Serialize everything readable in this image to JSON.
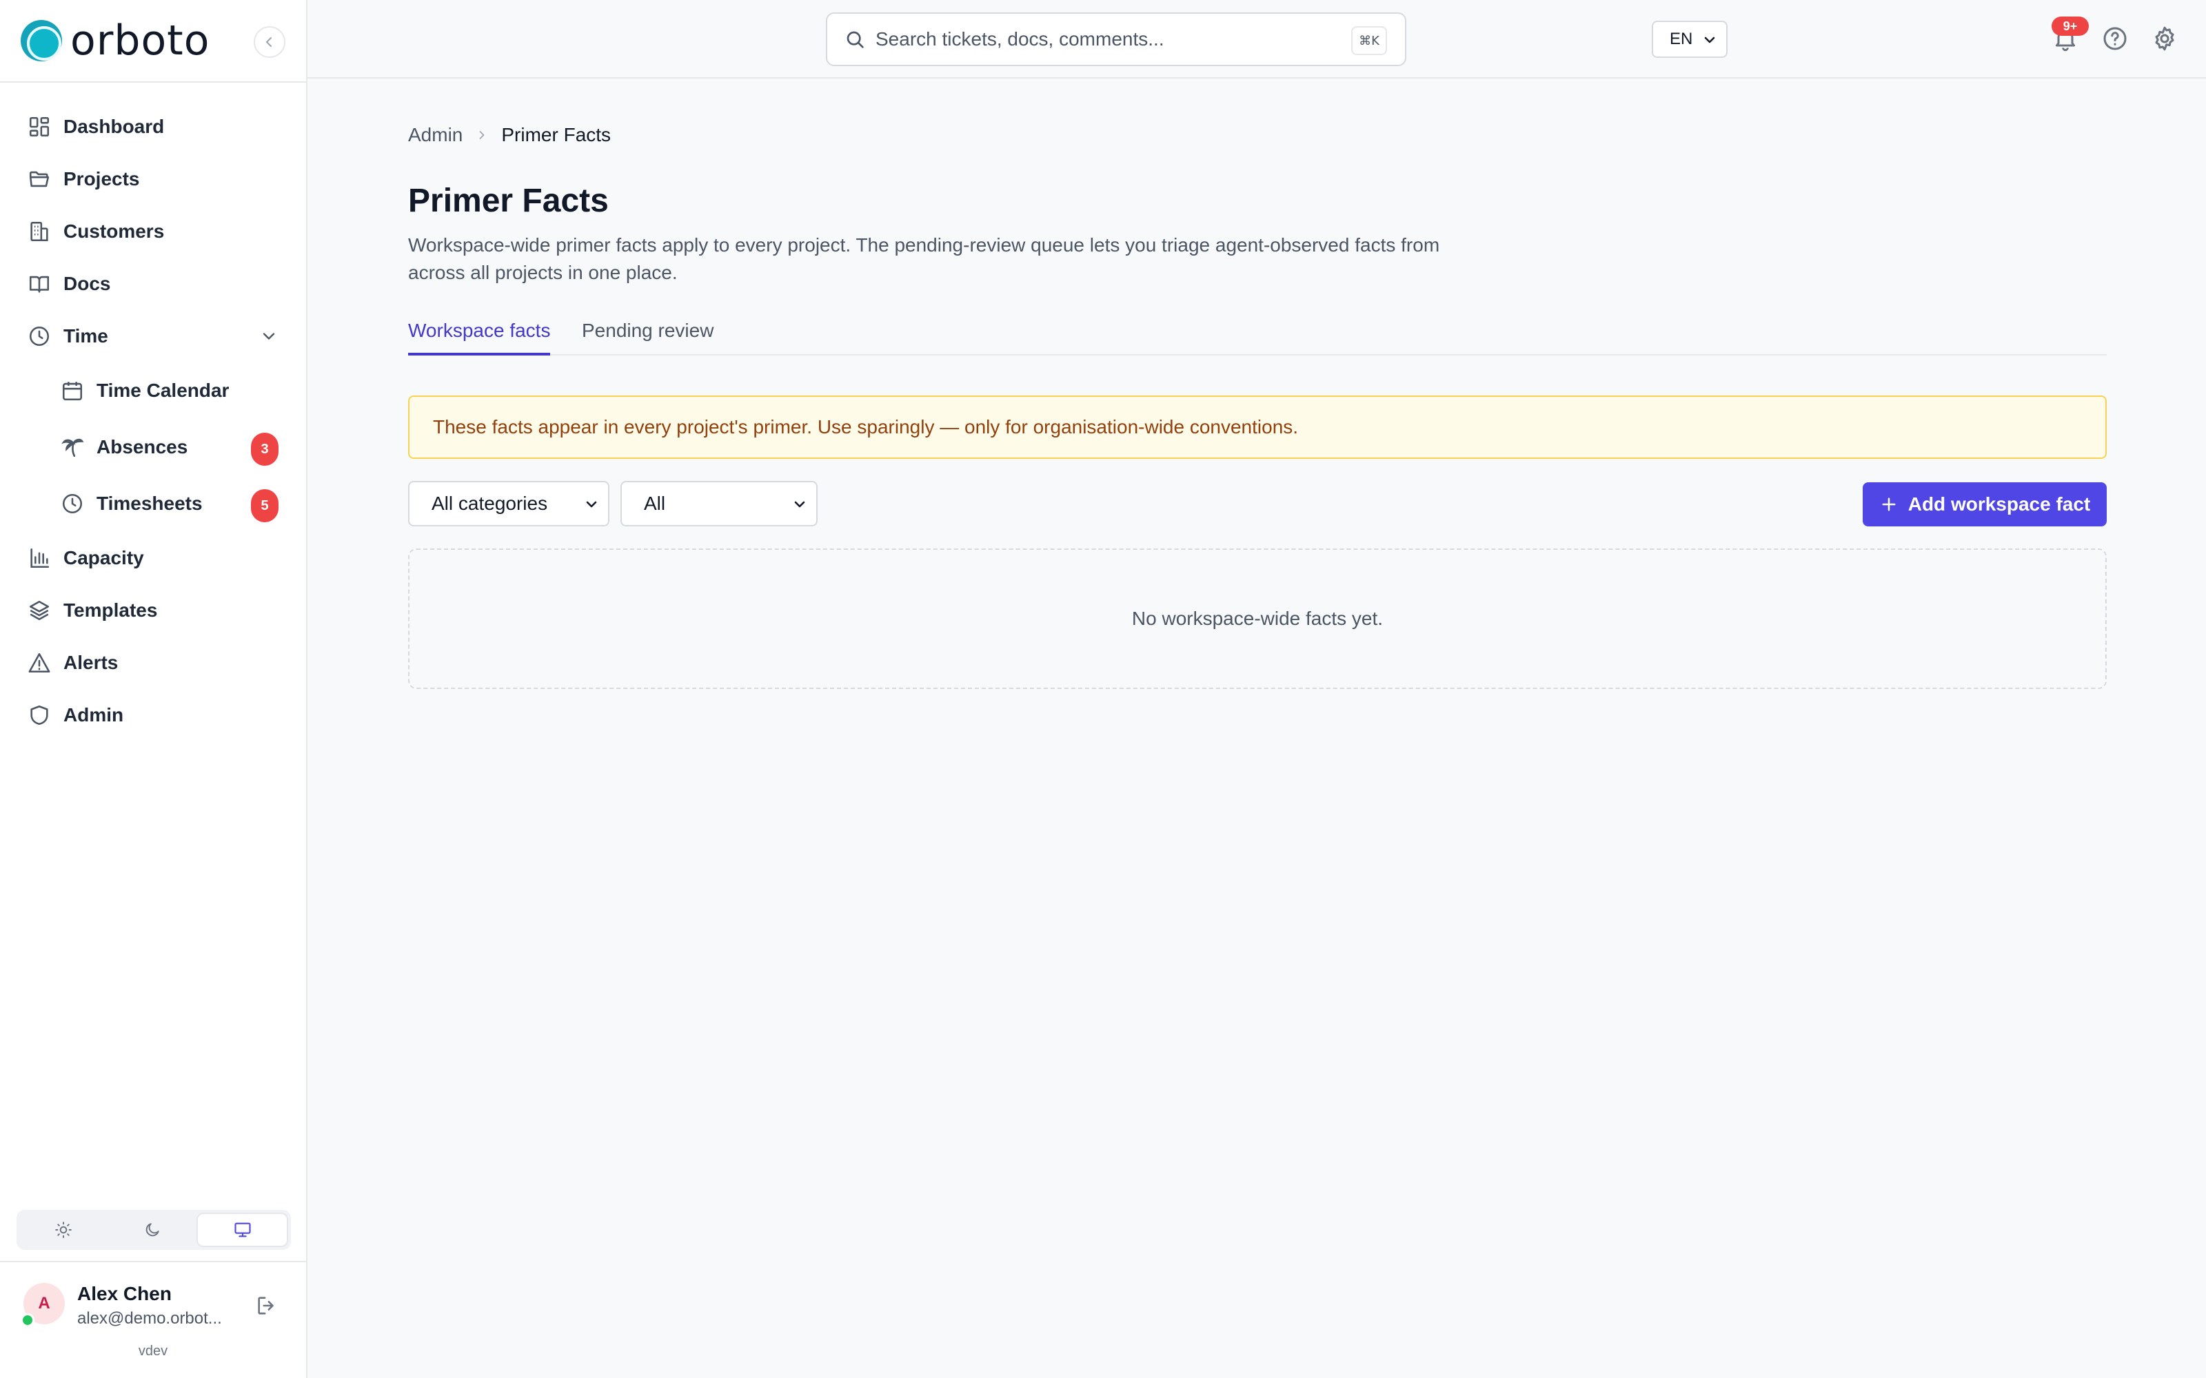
{
  "brand": {
    "name": "orboto"
  },
  "sidebar": {
    "items": [
      {
        "label": "Dashboard",
        "icon": "dashboard-icon"
      },
      {
        "label": "Projects",
        "icon": "folder-icon"
      },
      {
        "label": "Customers",
        "icon": "building-icon"
      },
      {
        "label": "Docs",
        "icon": "book-icon"
      },
      {
        "label": "Time",
        "icon": "clock-icon",
        "expanded": true
      },
      {
        "label": "Time Calendar",
        "icon": "calendar-icon"
      },
      {
        "label": "Absences",
        "icon": "palm-tree-icon",
        "badge": "3"
      },
      {
        "label": "Timesheets",
        "icon": "clock-icon",
        "badge": "5"
      },
      {
        "label": "Capacity",
        "icon": "bar-chart-icon"
      },
      {
        "label": "Templates",
        "icon": "layers-icon"
      },
      {
        "label": "Alerts",
        "icon": "warning-icon"
      },
      {
        "label": "Admin",
        "icon": "shield-icon"
      }
    ],
    "theme": {
      "options": [
        "light",
        "dark",
        "system"
      ],
      "selected": "system"
    },
    "user": {
      "initial": "A",
      "name": "Alex Chen",
      "email": "alex@demo.orbot...",
      "status": "online",
      "version": "vdev"
    }
  },
  "topbar": {
    "search_placeholder": "Search tickets, docs, comments...",
    "search_shortcut": "⌘K",
    "language": "EN",
    "notifications_badge": "9+"
  },
  "breadcrumb": {
    "parent": "Admin",
    "current": "Primer Facts"
  },
  "page": {
    "title": "Primer Facts",
    "description": "Workspace-wide primer facts apply to every project. The pending-review queue lets you triage agent-observed facts from across all projects in one place."
  },
  "tabs": [
    {
      "label": "Workspace facts",
      "active": true
    },
    {
      "label": "Pending review",
      "active": false
    }
  ],
  "warning": "These facts appear in every project's primer. Use sparingly — only for organisation-wide conventions.",
  "filters": {
    "category": "All categories",
    "status": "All"
  },
  "add_button": "Add workspace fact",
  "empty_state": "No workspace-wide facts yet.",
  "colors": {
    "accent": "#4f46e5",
    "brand": "#14a3b8",
    "badge": "#ef4444",
    "warning_bg": "#fefce8",
    "warning_text": "#92400e"
  }
}
